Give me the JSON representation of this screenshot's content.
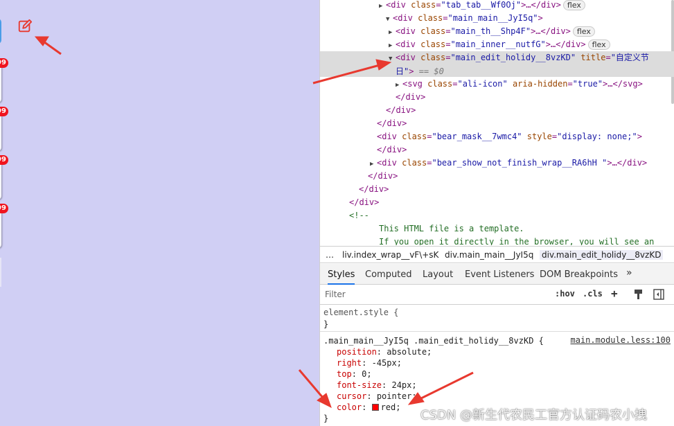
{
  "app": {
    "badges": [
      "99",
      "99",
      "99",
      "99"
    ]
  },
  "elements_tree": [
    {
      "tri": "▶",
      "open": "<div ",
      "attr": "class",
      "val": "\"tab_tab__Wf0Oj\"",
      "close": ">…</div>",
      "pill": "flex"
    },
    {
      "tri": "▼",
      "open": "<div ",
      "attr": "class",
      "val": "\"main_main__JyI5q\"",
      "close": ">",
      "pill": ""
    },
    {
      "tri": "▶",
      "open": "<div ",
      "attr": "class",
      "val": "\"main_th__Shp4F\"",
      "close": ">…</div>",
      "pill": "flex"
    },
    {
      "tri": "▶",
      "open": "<div ",
      "attr": "class",
      "val": "\"main_inner__nutfG\"",
      "close": ">…</div>",
      "pill": "flex"
    }
  ],
  "selected_node": {
    "line1_open": "<div ",
    "attr1": "class",
    "val1": "\"main_edit_holidy__8vzKD\"",
    "attr2": " title",
    "val2a": "\"自定义节",
    "val2b": "日\"",
    "close": ">",
    "eq": " == $0"
  },
  "tree_after": [
    {
      "tri": "▶",
      "open": "<svg ",
      "attr": "class",
      "val": "\"ali-icon\"",
      "attr2": " aria-hidden",
      "val2": "\"true\"",
      "close": ">…</svg>"
    },
    {
      "text": "</div>"
    },
    {
      "text": "</div>"
    },
    {
      "text": "</div>"
    },
    {
      "open": "<div ",
      "attr": "class",
      "val": "\"bear_mask__7wmc4\"",
      "attr2": " style",
      "val2": "\"display: none;\"",
      "close": ">"
    },
    {
      "text": "</div>"
    },
    {
      "tri": "▶",
      "open": "<div ",
      "attr": "class",
      "val": "\"bear_show_not_finish_wrap__RA6hH \"",
      "close": ">…</div>"
    },
    {
      "text": "</div>"
    },
    {
      "text": "</div>"
    },
    {
      "text": "</div>"
    },
    {
      "comment": "<!--"
    },
    {
      "comment": "This HTML file is a template."
    },
    {
      "comment": "If you open it directly in the browser, you will see an"
    }
  ],
  "breadcrumbs": {
    "more": "…",
    "items": [
      "liv.index_wrap__vF\\+sK",
      "div.main_main__JyI5q",
      "div.main_edit_holidy__8vzKD"
    ]
  },
  "tabs": {
    "items": [
      "Styles",
      "Computed",
      "Layout",
      "Event Listeners",
      "DOM Breakpoints"
    ],
    "more": "»"
  },
  "filter": {
    "placeholder": "Filter",
    "hov": ":hov",
    "cls": ".cls",
    "plus": "+"
  },
  "element_style": {
    "selector": "element.style {",
    "close": "}"
  },
  "rule": {
    "selector": ".main_main__JyI5q .main_edit_holidy__8vzKD {",
    "source": "main.module.less:100",
    "props": [
      {
        "name": "position",
        "value": "absolute;"
      },
      {
        "name": "right",
        "value": "-45px;"
      },
      {
        "name": "top",
        "value": "0;"
      },
      {
        "name": "font-size",
        "value": "24px;"
      },
      {
        "name": "cursor",
        "value": "pointer;"
      },
      {
        "name": "color",
        "value": "red;",
        "swatch": "#ff0000"
      }
    ],
    "close": "}"
  },
  "watermark": "CSDN @新生代农民工官方认证码农小拽",
  "colors": {
    "app_bg": "#d0cff4",
    "icon_red": "#e8392f",
    "badge_red": "#f0141e",
    "arrow_red": "#e8392f",
    "tag": "#881280",
    "attr": "#994500",
    "value": "#1a1aa6",
    "prop": "#c80000"
  }
}
